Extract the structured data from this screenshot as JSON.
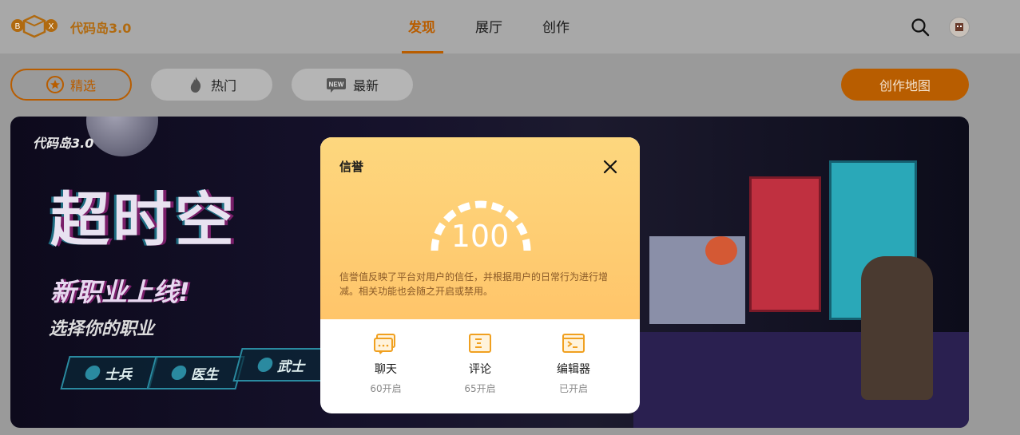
{
  "header": {
    "logo_letters": [
      "B",
      "X"
    ],
    "brand": "代码岛3.0",
    "tabs": [
      {
        "label": "发现",
        "active": true
      },
      {
        "label": "展厅",
        "active": false
      },
      {
        "label": "创作",
        "active": false
      }
    ],
    "icons": {
      "search": "search-icon",
      "avatar": "avatar"
    }
  },
  "filters": {
    "chips": [
      {
        "label": "精选",
        "icon": "star-icon",
        "selected": true
      },
      {
        "label": "热门",
        "icon": "fire-icon",
        "selected": false
      },
      {
        "label": "最新",
        "icon": "new-badge-icon",
        "icon_text": "NEW",
        "selected": false
      }
    ],
    "create_map_label": "创作地图"
  },
  "banner": {
    "brand": "代码岛3.0",
    "title": "超时空",
    "subtitle": "新职业上线!",
    "subtitle2": "选择你的职业",
    "roles": [
      "士兵",
      "医生",
      "武士"
    ]
  },
  "modal": {
    "title": "信誉",
    "score": "100",
    "description": "信誉值反映了平台对用户的信任，并根据用户的日常行为进行增减。相关功能也会随之开启或禁用。",
    "features": [
      {
        "name": "聊天",
        "status": "60开启",
        "icon": "chat-icon"
      },
      {
        "name": "评论",
        "status": "65开启",
        "icon": "comment-icon"
      },
      {
        "name": "编辑器",
        "status": "已开启",
        "icon": "editor-icon"
      }
    ]
  },
  "colors": {
    "accent": "#b85d00",
    "modal_gradient_top": "#fdd77e",
    "modal_gradient_bottom": "#ffc56a"
  }
}
